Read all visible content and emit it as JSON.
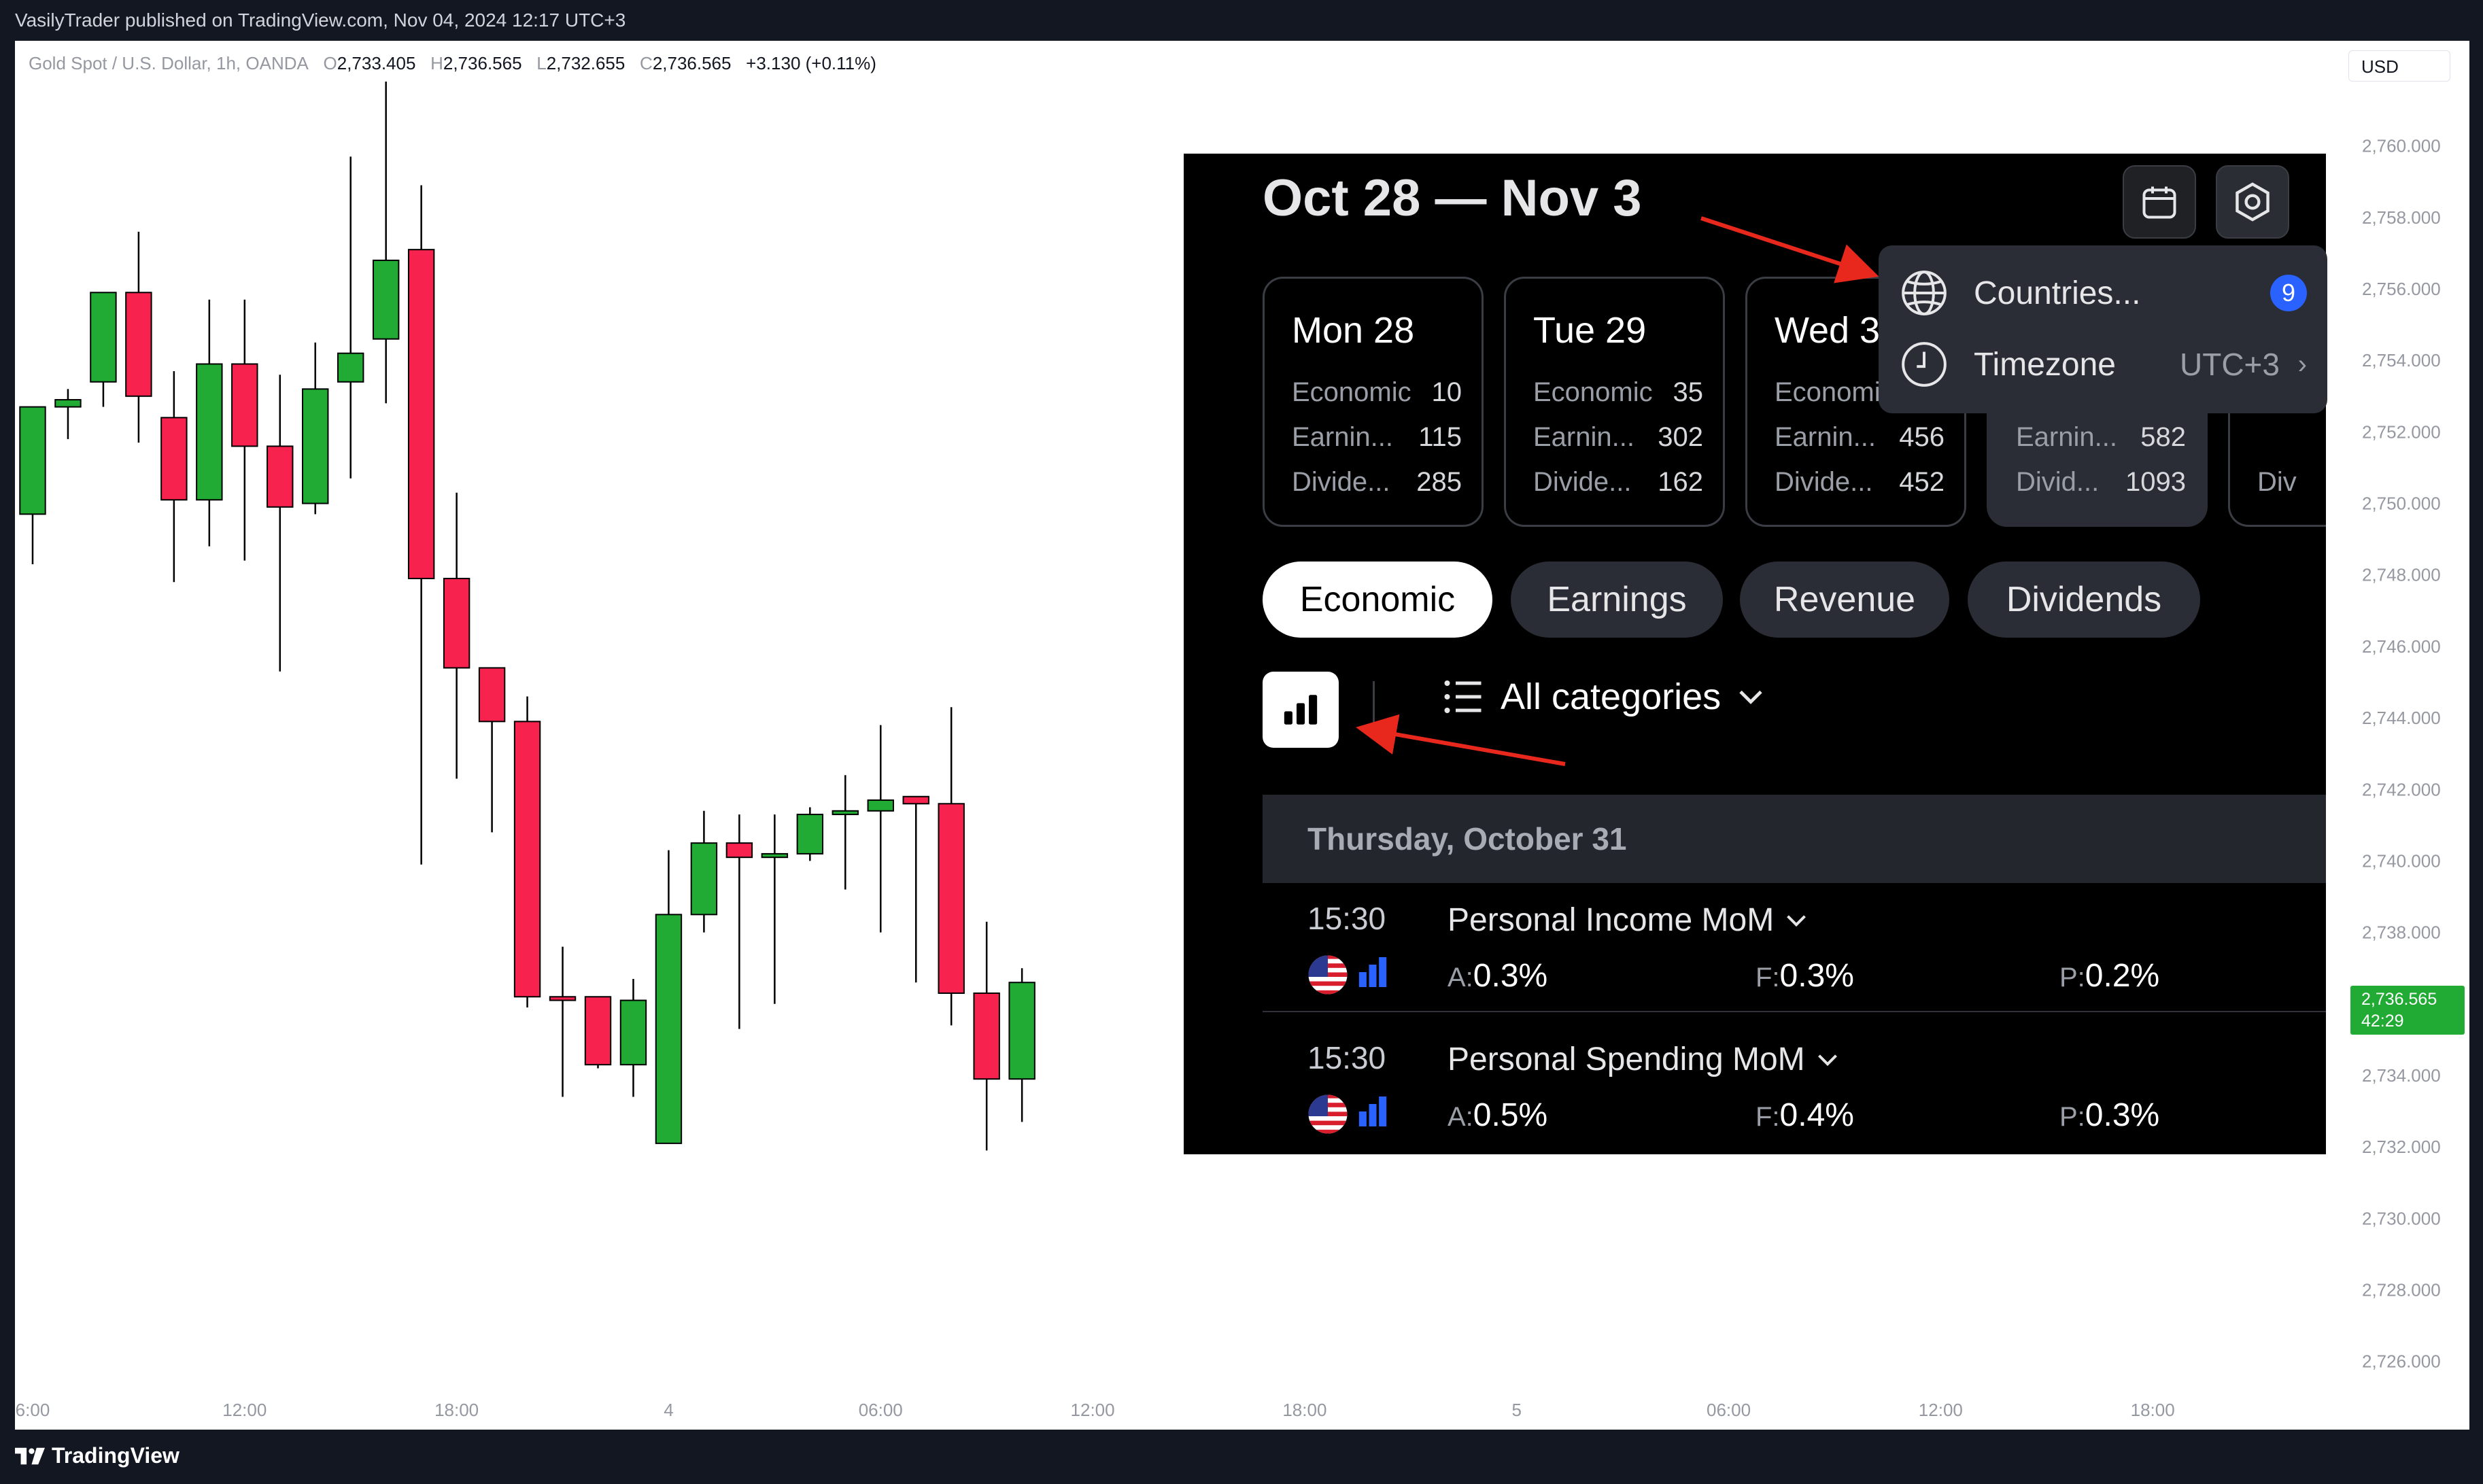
{
  "top_bar": {
    "text": "VasilyTrader published on TradingView.com, Nov 04, 2024 12:17 UTC+3"
  },
  "legend": {
    "symbol": "Gold Spot / U.S. Dollar, 1h, OANDA",
    "o_label": "O",
    "o": "2,733.405",
    "h_label": "H",
    "h": "2,736.565",
    "l_label": "L",
    "l": "2,732.655",
    "c_label": "C",
    "c": "2,736.565",
    "change": "+3.130 (+0.11%)"
  },
  "currency": "USD",
  "price_badge": {
    "price": "2,736.565",
    "countdown": "42:29"
  },
  "colors": {
    "up": "#22ab34",
    "down": "#f7224d",
    "panel_bg": "#000000",
    "accent": "#2962ff",
    "arrow": "#e8281c"
  },
  "chart_data": {
    "type": "candlestick",
    "y_ticks": [
      "2,760.000",
      "2,758.000",
      "2,756.000",
      "2,754.000",
      "2,752.000",
      "2,750.000",
      "2,748.000",
      "2,746.000",
      "2,744.000",
      "2,742.000",
      "2,740.000",
      "2,738.000",
      "2,736.000",
      "2,734.000",
      "2,732.000",
      "2,730.000",
      "2,728.000",
      "2,726.000"
    ],
    "y_tick_values": [
      2760,
      2758,
      2756,
      2754,
      2752,
      2750,
      2748,
      2746,
      2744,
      2742,
      2740,
      2738,
      2736,
      2734,
      2732,
      2730,
      2728,
      2726
    ],
    "ylim": [
      2725.1,
      2761.8
    ],
    "x_ticks": [
      {
        "label": "6:00",
        "bar": 0
      },
      {
        "label": "12:00",
        "bar": 6
      },
      {
        "label": "18:00",
        "bar": 12
      },
      {
        "label": "4",
        "bar": 18
      },
      {
        "label": "06:00",
        "bar": 24
      },
      {
        "label": "12:00",
        "bar": 30
      },
      {
        "label": "18:00",
        "bar": 36
      },
      {
        "label": "5",
        "bar": 42
      },
      {
        "label": "06:00",
        "bar": 48
      },
      {
        "label": "12:00",
        "bar": 54
      },
      {
        "label": "18:00",
        "bar": 60
      }
    ],
    "bars_visible": 66,
    "candles": [
      {
        "o": 2749.7,
        "h": 2752.5,
        "l": 2748.3,
        "c": 2752.7
      },
      {
        "o": 2752.7,
        "h": 2753.2,
        "l": 2751.8,
        "c": 2752.9
      },
      {
        "o": 2753.4,
        "h": 2755.9,
        "l": 2752.7,
        "c": 2755.9
      },
      {
        "o": 2755.9,
        "h": 2757.6,
        "l": 2751.7,
        "c": 2753.0
      },
      {
        "o": 2752.4,
        "h": 2753.7,
        "l": 2747.8,
        "c": 2750.1
      },
      {
        "o": 2750.1,
        "h": 2755.7,
        "l": 2748.8,
        "c": 2753.9
      },
      {
        "o": 2753.9,
        "h": 2755.7,
        "l": 2748.4,
        "c": 2751.6
      },
      {
        "o": 2751.6,
        "h": 2753.6,
        "l": 2745.3,
        "c": 2749.9
      },
      {
        "o": 2750.0,
        "h": 2754.5,
        "l": 2749.7,
        "c": 2753.2
      },
      {
        "o": 2753.4,
        "h": 2759.7,
        "l": 2750.7,
        "c": 2754.2
      },
      {
        "o": 2754.6,
        "h": 2761.8,
        "l": 2752.8,
        "c": 2756.8
      },
      {
        "o": 2757.1,
        "h": 2758.9,
        "l": 2739.9,
        "c": 2747.9
      },
      {
        "o": 2747.9,
        "h": 2750.3,
        "l": 2742.3,
        "c": 2745.4
      },
      {
        "o": 2745.4,
        "h": 2743.5,
        "l": 2740.8,
        "c": 2743.9
      },
      {
        "o": 2743.9,
        "h": 2744.6,
        "l": 2735.9,
        "c": 2736.2
      },
      {
        "o": 2736.2,
        "h": 2737.6,
        "l": 2733.4,
        "c": 2736.1
      },
      {
        "o": 2736.2,
        "h": 2736.2,
        "l": 2734.2,
        "c": 2734.3
      },
      {
        "o": 2734.3,
        "h": 2736.7,
        "l": 2733.4,
        "c": 2736.1
      },
      {
        "o": 2732.1,
        "h": 2740.3,
        "l": 2732.1,
        "c": 2738.5
      },
      {
        "o": 2738.5,
        "h": 2741.4,
        "l": 2738.0,
        "c": 2740.5
      },
      {
        "o": 2740.5,
        "h": 2741.3,
        "l": 2735.3,
        "c": 2740.1
      },
      {
        "o": 2740.1,
        "h": 2741.3,
        "l": 2736.0,
        "c": 2740.2
      },
      {
        "o": 2740.2,
        "h": 2741.5,
        "l": 2740.0,
        "c": 2741.3
      },
      {
        "o": 2741.3,
        "h": 2742.4,
        "l": 2739.2,
        "c": 2741.4
      },
      {
        "o": 2741.4,
        "h": 2743.8,
        "l": 2738.0,
        "c": 2741.7
      },
      {
        "o": 2741.8,
        "h": 2741.6,
        "l": 2736.6,
        "c": 2741.6
      },
      {
        "o": 2741.6,
        "h": 2744.3,
        "l": 2735.4,
        "c": 2736.3
      },
      {
        "o": 2736.3,
        "h": 2738.3,
        "l": 2731.9,
        "c": 2733.9
      },
      {
        "o": 2733.9,
        "h": 2737.0,
        "l": 2732.7,
        "c": 2736.6
      }
    ]
  },
  "panel": {
    "range_title": "Oct 28 — Nov 3",
    "days": [
      {
        "name": "Mon 28",
        "rows": [
          {
            "k": "Economic",
            "v": "10"
          },
          {
            "k": "Earnin...",
            "v": "115"
          },
          {
            "k": "Divide...",
            "v": "285"
          }
        ]
      },
      {
        "name": "Tue 29",
        "rows": [
          {
            "k": "Economic",
            "v": "35"
          },
          {
            "k": "Earnin...",
            "v": "302"
          },
          {
            "k": "Divide...",
            "v": "162"
          }
        ]
      },
      {
        "name": "Wed 3",
        "rows": [
          {
            "k": "Economi",
            "v": ""
          },
          {
            "k": "Earnin...",
            "v": "456"
          },
          {
            "k": "Divide...",
            "v": "452"
          }
        ]
      },
      {
        "name": "",
        "rows": [
          {
            "k": "",
            "v": ""
          },
          {
            "k": "Earnin...",
            "v": "582"
          },
          {
            "k": "Divid...",
            "v": "1093"
          }
        ]
      },
      {
        "name": "",
        "rows": [
          {
            "k": "",
            "v": ""
          },
          {
            "k": "",
            "v": ""
          },
          {
            "k": "Div",
            "v": ""
          }
        ]
      }
    ],
    "tabs": [
      "Economic",
      "Earnings",
      "Revenue",
      "Dividends"
    ],
    "filter_label": "All categories",
    "date_header": "Thursday, October 31",
    "events": [
      {
        "time": "15:30",
        "name": "Personal Income MoM",
        "a_label": "A:",
        "a": "0.3%",
        "f_label": "F:",
        "f": "0.3%",
        "p_label": "P:",
        "p": "0.2%"
      },
      {
        "time": "15:30",
        "name": "Personal Spending MoM",
        "a_label": "A:",
        "a": "0.5%",
        "f_label": "F:",
        "f": "0.4%",
        "p_label": "P:",
        "p": "0.3%"
      }
    ],
    "dropdown": {
      "countries_label": "Countries...",
      "countries_count": "9",
      "timezone_label": "Timezone",
      "timezone_value": "UTC+3"
    }
  },
  "bottom_bar": {
    "logo_text": "TradingView"
  }
}
